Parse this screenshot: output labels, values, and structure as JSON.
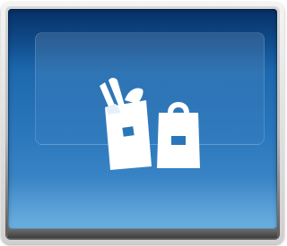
{
  "tile": {
    "icon": "shopping-bags-icon",
    "accent_color": "#2a76bb",
    "icon_color": "#ffffff"
  }
}
